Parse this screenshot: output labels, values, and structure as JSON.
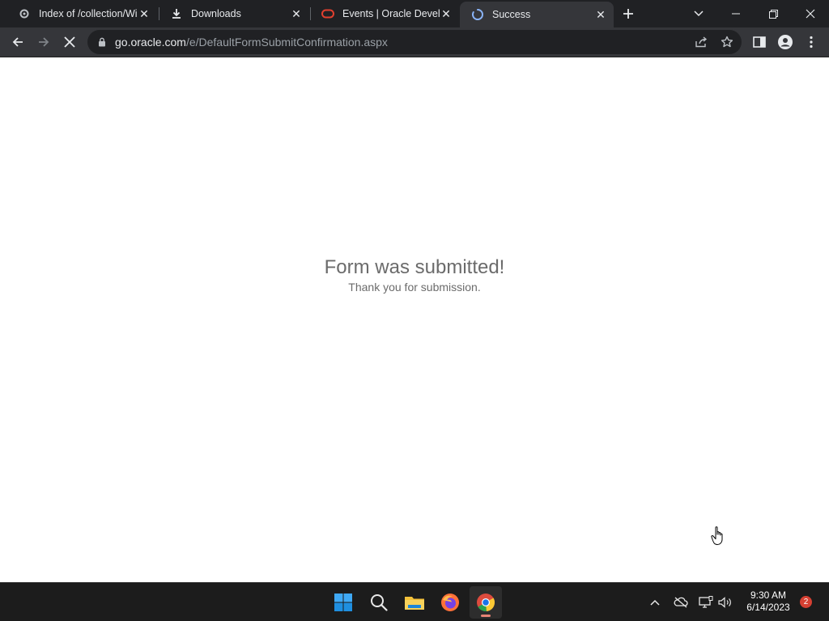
{
  "browser": {
    "tabs": [
      {
        "title": "Index of /collection/Wi",
        "icon": "gear-favicon"
      },
      {
        "title": "Downloads",
        "icon": "download-icon"
      },
      {
        "title": "Events | Oracle Develop",
        "icon": "oracle-icon"
      },
      {
        "title": "Success",
        "icon": "loading-spinner-icon"
      }
    ],
    "address": {
      "host": "go.oracle.com",
      "path": "/e/DefaultFormSubmitConfirmation.aspx"
    }
  },
  "page": {
    "heading": "Form was submitted!",
    "subtext": "Thank you for submission."
  },
  "taskbar": {
    "apps": [
      "windows-start",
      "search",
      "file-explorer",
      "firefox",
      "chrome"
    ],
    "time": "9:30 AM",
    "date": "6/14/2023",
    "notification_count": "2"
  },
  "colors": {
    "tab_bg": "#202124",
    "toolbar_bg": "#35363a",
    "oracle_red": "#e2402f",
    "page_text": "#6b6b6b"
  }
}
